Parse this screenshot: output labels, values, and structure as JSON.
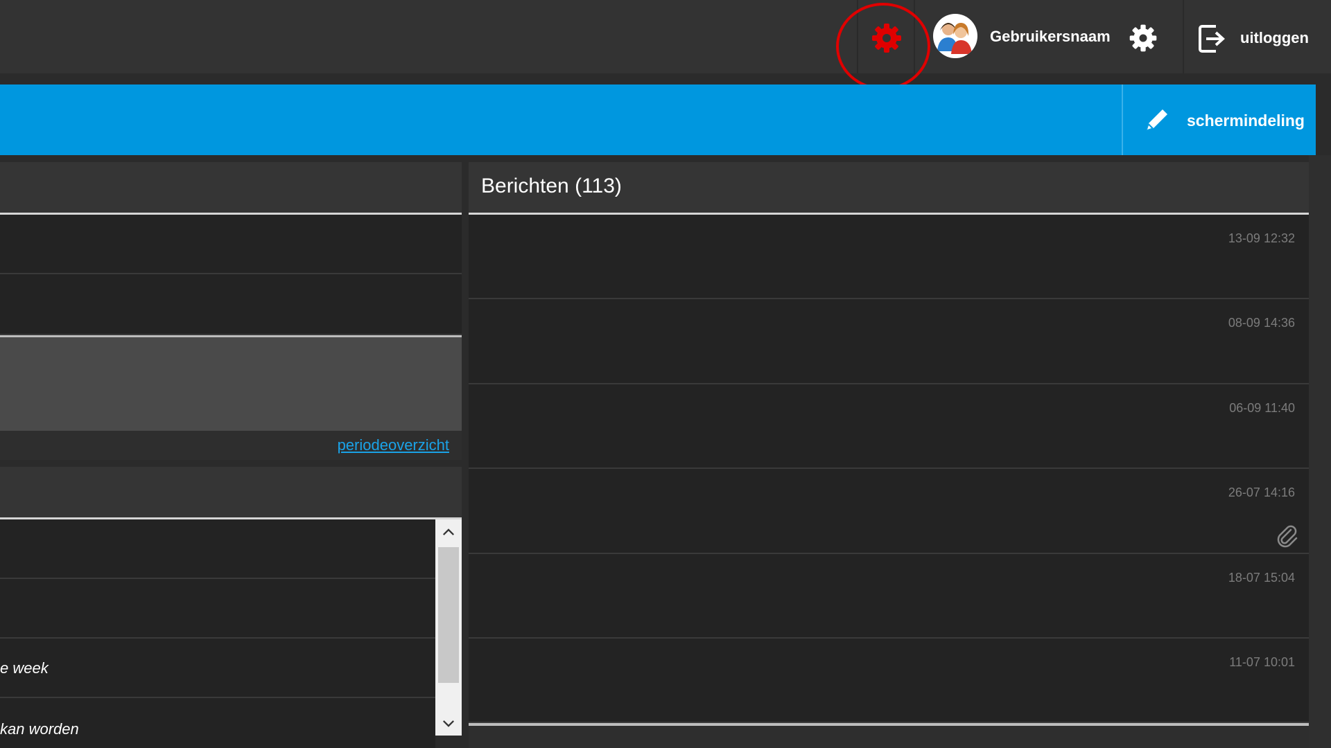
{
  "topbar": {
    "username": "Gebruikersnaam",
    "logout_label": "uitloggen"
  },
  "bluebar": {
    "layout_label": "schermindeling"
  },
  "left_panel": {
    "period_link": "periodeoverzicht",
    "list_items": [
      "",
      "",
      "e week",
      "kan worden"
    ]
  },
  "messages": {
    "title": "Berichten (113)",
    "items": [
      {
        "date": "13-09 12:32",
        "attachment": false
      },
      {
        "date": "08-09 14:36",
        "attachment": false
      },
      {
        "date": "06-09 11:40",
        "attachment": false
      },
      {
        "date": "26-07 14:16",
        "attachment": true
      },
      {
        "date": "18-07 15:04",
        "attachment": false
      },
      {
        "date": "11-07 10:01",
        "attachment": false
      }
    ]
  },
  "colors": {
    "accent_blue": "#0097df",
    "highlight_red": "#e00000",
    "link_blue": "#1aa3e8"
  },
  "icons": [
    "settings-gear-red-icon",
    "avatar-users-icon",
    "settings-gear-icon",
    "logout-icon",
    "pencil-icon",
    "paperclip-icon",
    "chevron-up-icon",
    "chevron-down-icon"
  ]
}
